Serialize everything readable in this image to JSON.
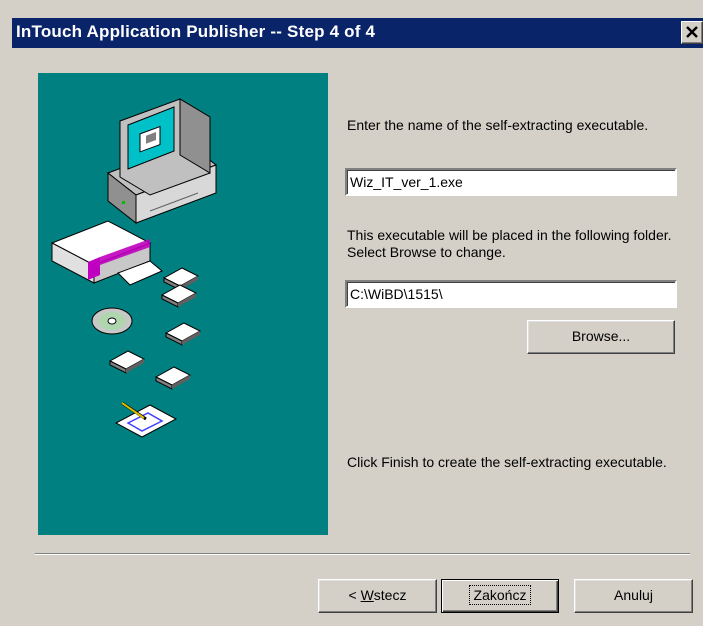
{
  "window": {
    "title": "InTouch Application Publisher -- Step 4 of 4",
    "close_glyph": "✕"
  },
  "content": {
    "name_prompt": "Enter the name of the self-extracting executable.",
    "name_value": "Wiz_IT_ver_1.exe",
    "folder_prompt": "This executable will be placed in the following folder. Select Browse to change.",
    "folder_value": "C:\\WiBD\\1515\\",
    "browse_label": "Browse...",
    "finish_hint": "Click Finish to create the self-extracting executable."
  },
  "buttons": {
    "back_prefix": "< ",
    "back_mnemonic": "W",
    "back_rest": "stecz",
    "finish_label": "Zakończ",
    "cancel_label": "Anuluj"
  },
  "art": {
    "icons": [
      "computer-icon",
      "software-box-icon",
      "floppy-disk-icon",
      "cd-icon",
      "document-pen-icon"
    ],
    "background_color": "#008080"
  }
}
